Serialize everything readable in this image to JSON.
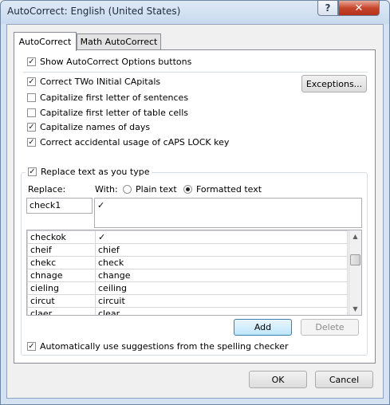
{
  "window": {
    "title": "AutoCorrect: English (United States)",
    "help": "?",
    "close": "✕"
  },
  "tabs": [
    {
      "label": "AutoCorrect",
      "active": true
    },
    {
      "label": "Math AutoCorrect",
      "active": false
    }
  ],
  "options": {
    "show_buttons": {
      "label": "Show AutoCorrect Options buttons",
      "checked": true
    },
    "two_initial": {
      "label": "Correct TWo INitial CApitals",
      "checked": true
    },
    "first_sentence": {
      "label": "Capitalize first letter of sentences",
      "checked": false
    },
    "first_cell": {
      "label": "Capitalize first letter of table cells",
      "checked": false
    },
    "day_names": {
      "label": "Capitalize names of days",
      "checked": true
    },
    "caps_lock": {
      "label": "Correct accidental usage of cAPS LOCK key",
      "checked": true
    },
    "exceptions_button": "Exceptions..."
  },
  "replace_section": {
    "replace_as_type": {
      "label": "Replace text as you type",
      "checked": true
    },
    "replace_label": "Replace:",
    "with_label": "With:",
    "plain_text": {
      "label": "Plain text",
      "selected": false
    },
    "formatted_text": {
      "label": "Formatted text",
      "selected": true
    },
    "replace_value": "check1",
    "with_value": "✓"
  },
  "entries": [
    {
      "replace": "checkok",
      "with": "✓"
    },
    {
      "replace": "cheif",
      "with": "chief"
    },
    {
      "replace": "chekc",
      "with": "check"
    },
    {
      "replace": "chnage",
      "with": "change"
    },
    {
      "replace": "cieling",
      "with": "ceiling"
    },
    {
      "replace": "circut",
      "with": "circuit"
    },
    {
      "replace": "claer",
      "with": "clear"
    }
  ],
  "list_buttons": {
    "add": "Add",
    "delete": "Delete"
  },
  "spelling": {
    "label": "Automatically use suggestions from the spelling checker",
    "checked": true
  },
  "footer": {
    "ok": "OK",
    "cancel": "Cancel"
  },
  "icons": {
    "check": "✓",
    "scroll_up": "▲",
    "scroll_down": "▼"
  }
}
